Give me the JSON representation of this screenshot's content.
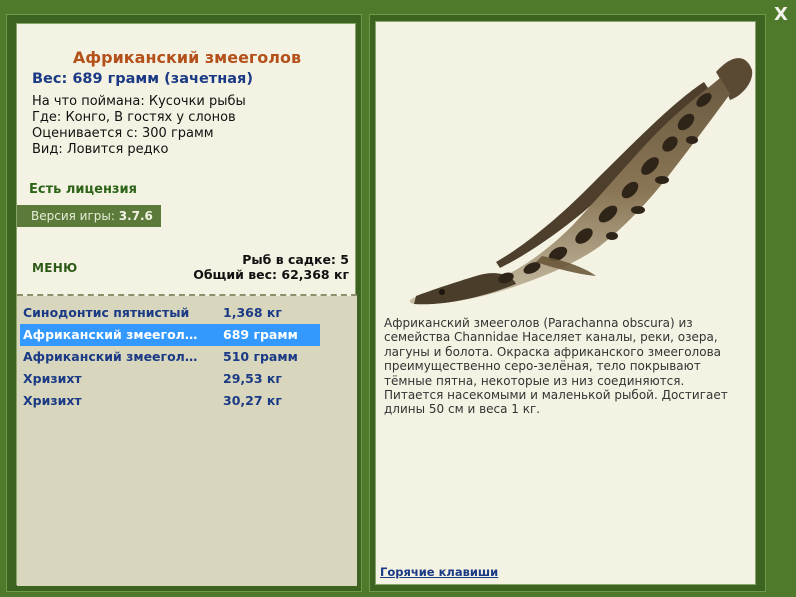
{
  "window": {
    "close_label": "X"
  },
  "fish": {
    "title": "Африканский змееголов",
    "weight_label": "Вес:",
    "weight_value": "689 грамм",
    "weight_category": "(зачетная)",
    "info": [
      {
        "label": "На что поймана:",
        "value": "Кусочки рыбы"
      },
      {
        "label": "Где:",
        "value": "Конго, В гостях у слонов"
      },
      {
        "label": "Оценивается с:",
        "value": "300 грамм"
      },
      {
        "label": "Вид:",
        "value": "Ловится редко"
      }
    ],
    "license": "Есть лицензия"
  },
  "version": {
    "label": "Версия игры:",
    "value": "3.7.6"
  },
  "menu_label": "МЕНЮ",
  "cage": {
    "count_label": "Рыб в садке:",
    "count_value": "5",
    "total_label": "Общий вес:",
    "total_value": "62,368 кг"
  },
  "catch_list": [
    {
      "name": "Синодонтис пятнистый",
      "weight": "1,368 кг",
      "selected": false
    },
    {
      "name": "Африканский змееголо...",
      "weight": "689 грамм",
      "selected": true
    },
    {
      "name": "Африканский змееголо...",
      "weight": "510 грамм",
      "selected": false
    },
    {
      "name": "Хризихт",
      "weight": "29,53 кг",
      "selected": false
    },
    {
      "name": "Хризихт",
      "weight": "30,27 кг",
      "selected": false
    }
  ],
  "description": "Африканский змееголов (Parachanna obscura) из семейства Channidae Населяет каналы, реки, озера, лагуны и болота. Окраска африканского змееголова преимущественно серо-зелёная, тело покрывают тёмные пятна, некоторые из низ соединяются. Питается насекомыми и маленькой рыбой. Достигает длины 50 см и веса 1 кг.",
  "hotkeys_label": "Горячие клавиши",
  "colors": {
    "frame_green": "#4f7a2c",
    "panel_bg": "#f4f3e3",
    "list_bg": "#d8d7bd",
    "title_orange": "#b4511b",
    "text_blue": "#1b3a85",
    "selection_blue": "#3399ff"
  }
}
